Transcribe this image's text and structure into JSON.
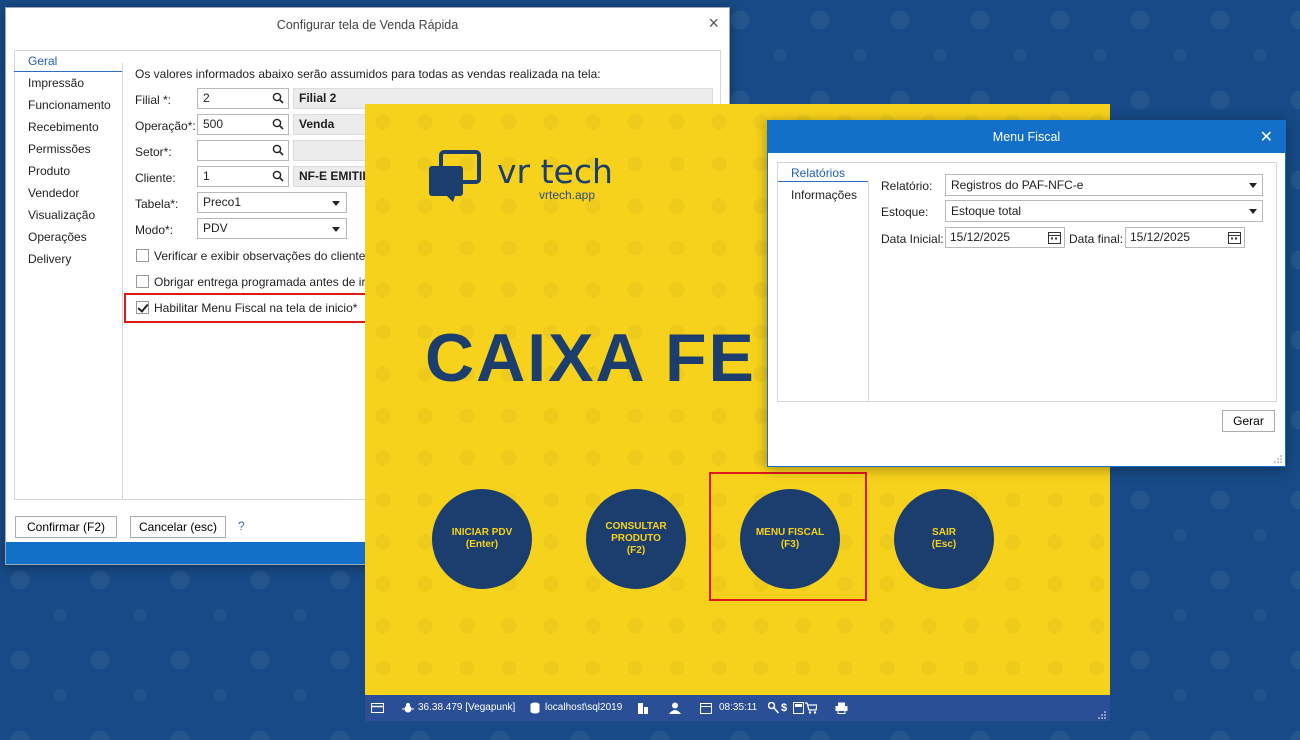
{
  "config_dialog": {
    "title": "Configurar tela de Venda Rápida",
    "close": "×",
    "sidebar": [
      {
        "label": "Geral",
        "active": true
      },
      {
        "label": "Impressão"
      },
      {
        "label": "Funcionamento"
      },
      {
        "label": "Recebimento"
      },
      {
        "label": "Permissões"
      },
      {
        "label": "Produto"
      },
      {
        "label": "Vendedor"
      },
      {
        "label": "Visualização"
      },
      {
        "label": "Operações"
      },
      {
        "label": "Delivery"
      }
    ],
    "intro": "Os valores informados abaixo serão assumidos para todas as vendas realizada na tela:",
    "fields": {
      "filial": {
        "label": "Filial *:",
        "value": "2",
        "description": "Filial 2"
      },
      "operacao": {
        "label": "Operação*:",
        "value": "500",
        "description": "Venda"
      },
      "setor": {
        "label": "Setor*:",
        "value": "",
        "description": ""
      },
      "cliente": {
        "label": "Cliente:",
        "value": "1",
        "description": "NF-E EMITIDA"
      },
      "tabela": {
        "label": "Tabela*:",
        "value": "Preco1"
      },
      "modo": {
        "label": "Modo*:",
        "value": "PDV"
      }
    },
    "checkboxes": [
      {
        "label": "Verificar e exibir observações do cliente.",
        "checked": false
      },
      {
        "label": "Obrigar entrega programada antes de ir",
        "checked": false
      },
      {
        "label": "Habilitar Menu Fiscal na tela de inicio*",
        "checked": true
      }
    ],
    "buttons": {
      "confirm": "Confirmar (F2)",
      "cancel": "Cancelar (esc)",
      "help": "?"
    }
  },
  "pos_screen": {
    "logo_text": "vr tech",
    "logo_sub": "vrtech.app",
    "title": "CAIXA FE",
    "buttons": [
      {
        "line1": "INICIAR PDV",
        "line2": "(Enter)",
        "line3": ""
      },
      {
        "line1": "CONSULTAR",
        "line2": "PRODUTO",
        "line3": "(F2)"
      },
      {
        "line1": "MENU FISCAL",
        "line2": "(F3)",
        "line3": ""
      },
      {
        "line1": "SAIR",
        "line2": "(Esc)",
        "line3": ""
      }
    ],
    "status": {
      "version": "36.38.479 [Vegapunk]",
      "server": "localhost\\sql2019",
      "time": "08:35:11",
      "currency": "$"
    },
    "colors": {
      "background": "#f7d21c",
      "accent": "#1c3e6e",
      "status_bar": "#2a4f97"
    }
  },
  "fiscal_dialog": {
    "title": "Menu Fiscal",
    "close": "✕",
    "sidebar": [
      {
        "label": "Relatórios",
        "active": true
      },
      {
        "label": "Informações"
      }
    ],
    "relatorio": {
      "label": "Relatório:",
      "value": "Registros do PAF-NFC-e"
    },
    "estoque": {
      "label": "Estoque:",
      "value": "Estoque total"
    },
    "data_inicial": {
      "label": "Data Inicial:",
      "value": "15/12/2025"
    },
    "data_final": {
      "label": "Data final:",
      "value": "15/12/2025"
    },
    "gerar": "Gerar"
  }
}
